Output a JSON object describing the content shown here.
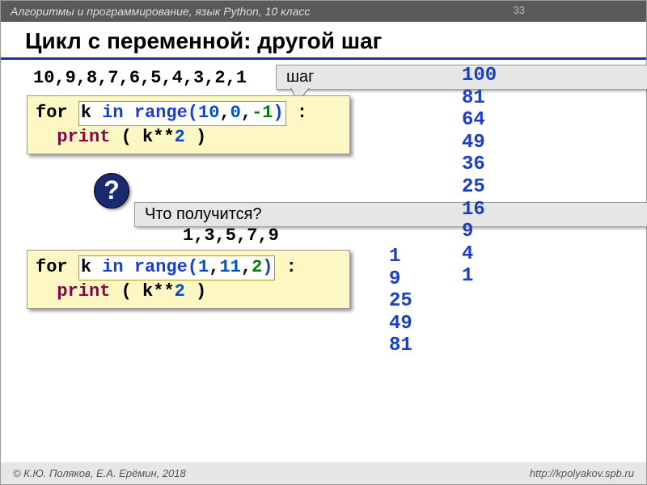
{
  "header": {
    "breadcrumb": "Алгоритмы и программирование, язык Python, 10 класс",
    "page_number": "33"
  },
  "title": "Цикл с переменной: другой шаг",
  "seq1": "10,9,8,7,6,5,4,3,2,1",
  "step_label": "шаг",
  "code1": {
    "for": "for",
    "k": "k ",
    "in": "in",
    "range": "range(",
    "a": "10",
    "c1": ",",
    "b": "0",
    "c2": ",",
    "step": "-1",
    "close": ")",
    "colon": " :",
    "print": "print",
    "body": " ( k**",
    "two": "2",
    "end": " )"
  },
  "question": {
    "mark": "?",
    "text": "Что получится?"
  },
  "seq2": "1,3,5,7,9",
  "code2": {
    "for": "for",
    "k": "k ",
    "in": "in",
    "range": "range(",
    "a": "1",
    "c1": ",",
    "b": "11",
    "c2": ",",
    "step": "2",
    "close": ")",
    "colon": " :",
    "print": "print",
    "body": " ( k**",
    "two": "2",
    "end": " )"
  },
  "output1": "100\n81\n64\n49\n36\n25\n16\n9\n4\n1",
  "output2": "1\n9\n25\n49\n81",
  "footer": {
    "left": "© К.Ю. Поляков, Е.А. Ерёмин, 2018",
    "right": "http://kpolyakov.spb.ru"
  }
}
